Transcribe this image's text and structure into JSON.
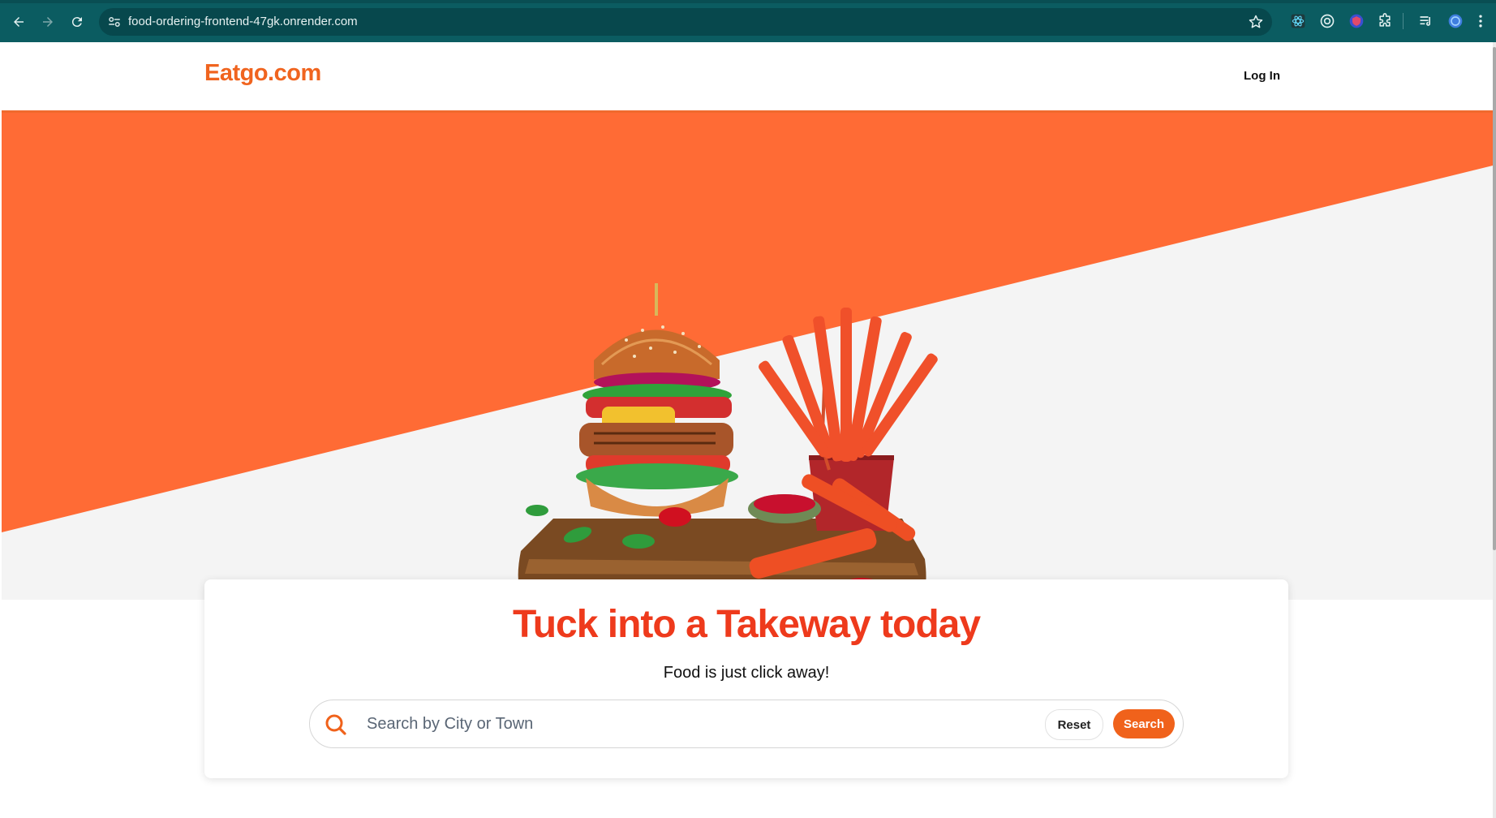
{
  "browser": {
    "url": "food-ordering-frontend-47gk.onrender.com",
    "nav": {
      "back_icon": "arrow-left",
      "forward_icon": "arrow-right",
      "reload_icon": "reload"
    },
    "extensions": [
      "react-devtools-icon",
      "target-icon",
      "shield-extension-icon",
      "puzzle-icon",
      "media-queue-icon",
      "profile-avatar-icon",
      "kebab-menu-icon"
    ]
  },
  "header": {
    "logo": "Eatgo.com",
    "login_label": "Log In"
  },
  "hero": {
    "image": "burger-and-fries-illustration",
    "colors": {
      "accent": "#ff6b35",
      "background": "#f4f4f4"
    }
  },
  "search_card": {
    "title": "Tuck into a Takeway today",
    "subtitle": "Food is just click away!",
    "search_placeholder": "Search by City or Town",
    "search_value": "",
    "reset_label": "Reset",
    "search_label": "Search"
  },
  "colors": {
    "brand": "#f0641f",
    "headline": "#ee3a1c",
    "button": "#f0621b"
  }
}
